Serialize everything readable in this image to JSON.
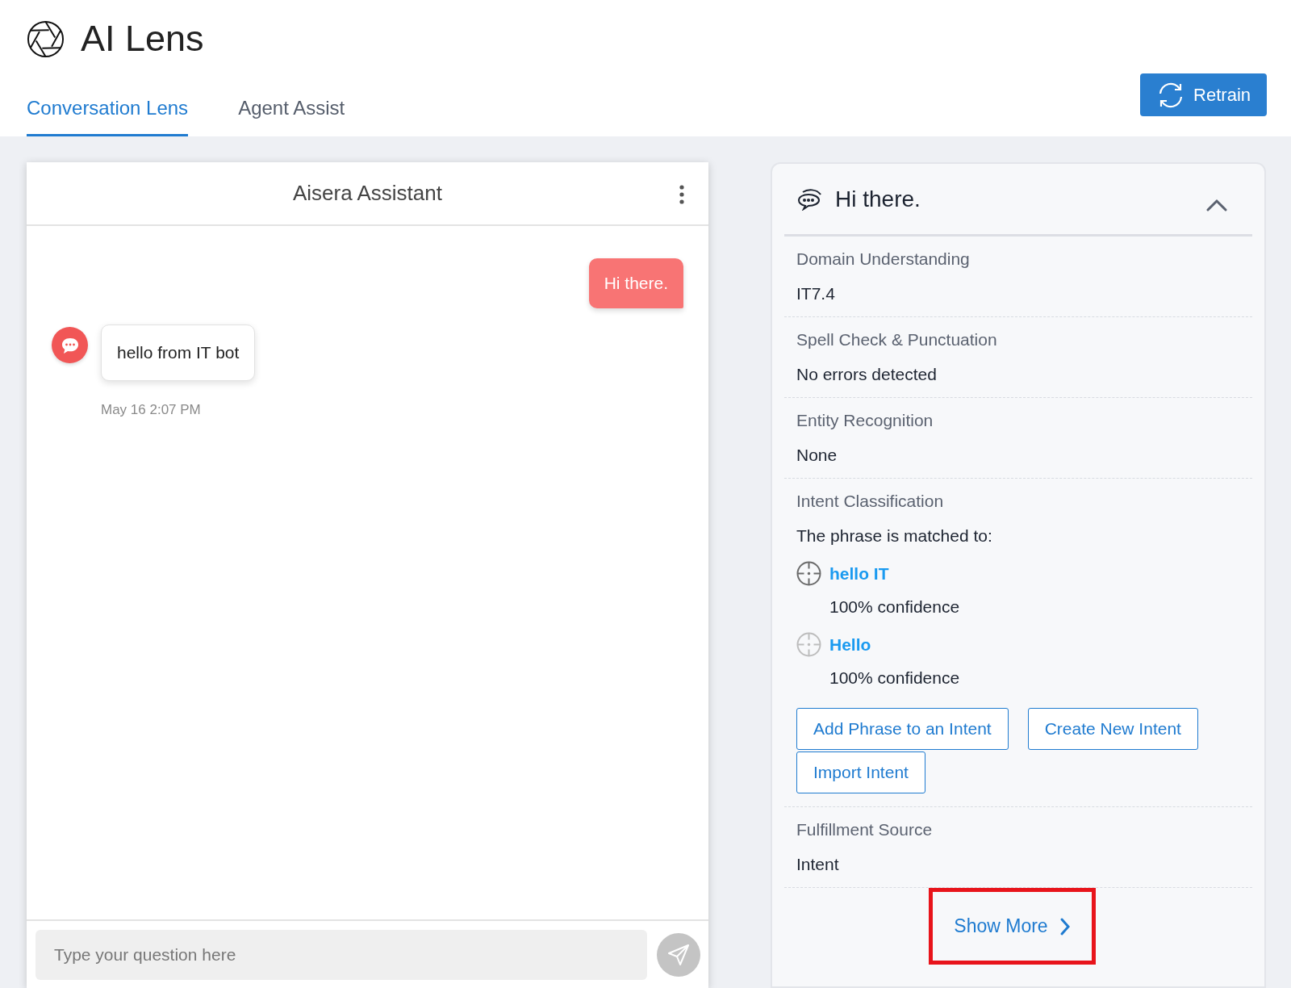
{
  "app": {
    "title": "AI Lens"
  },
  "tabs": [
    {
      "label": "Conversation Lens",
      "selected": true
    },
    {
      "label": "Agent Assist",
      "selected": false
    }
  ],
  "retrain_button": {
    "label": "Retrain"
  },
  "chat": {
    "title": "Aisera Assistant",
    "messages": [
      {
        "kind": "user",
        "text": "Hi there."
      },
      {
        "kind": "bot",
        "text": "hello from IT bot",
        "time": "May 16 2:07 PM"
      }
    ],
    "input": {
      "placeholder": "Type your question here"
    }
  },
  "analysis": {
    "title": "Hi there.",
    "expanded": true,
    "sections": [
      {
        "kind": "text",
        "label": "Domain Understanding",
        "value": "IT7.4"
      },
      {
        "kind": "text",
        "label": "Spell Check & Punctuation",
        "value": "No errors detected"
      },
      {
        "kind": "text",
        "label": "Entity Recognition",
        "value": "None"
      },
      {
        "kind": "intents",
        "label": "Intent Classification",
        "value": "The phrase is matched to:",
        "matches": [
          {
            "name": "hello IT",
            "confidence": "100% confidence",
            "selected": true
          },
          {
            "name": "Hello",
            "confidence": "100% confidence",
            "selected": false
          }
        ],
        "buttons": [
          "Add Phrase to an Intent",
          "Create New Intent",
          "Import Intent"
        ]
      },
      {
        "kind": "text",
        "label": "Fulfillment Source",
        "value": "Intent"
      }
    ],
    "show_more": {
      "label": "Show More",
      "highlighted": true
    }
  }
}
